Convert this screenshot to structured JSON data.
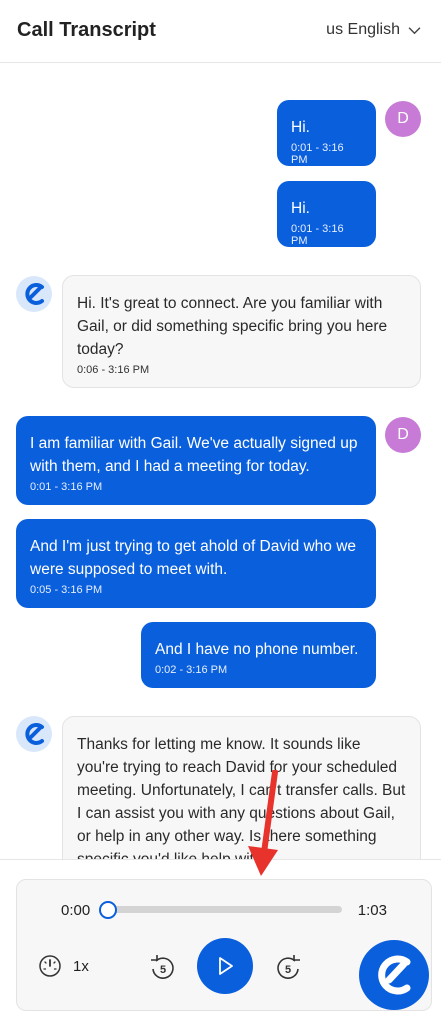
{
  "header": {
    "title": "Call Transcript",
    "language": "us English"
  },
  "messages": [
    {
      "role": "user",
      "avatar": "D",
      "text": "Hi.",
      "time": "0:01 - 3:16 PM"
    },
    {
      "role": "user",
      "avatar": "",
      "text": "Hi.",
      "time": "0:01 - 3:16 PM"
    },
    {
      "role": "assistant",
      "text": "Hi. It's great to connect. Are you familiar with Gail, or did something specific bring you here today?",
      "time": "0:06 - 3:16 PM"
    },
    {
      "role": "user",
      "avatar": "D",
      "text": "I am familiar with Gail. We've actually signed up with them, and I had a meeting for today.",
      "time": "0:01 - 3:16 PM"
    },
    {
      "role": "user",
      "avatar": "",
      "text": "And I'm just trying to get ahold of David who we were supposed to meet with.",
      "time": "0:05 - 3:16 PM"
    },
    {
      "role": "user",
      "avatar": "",
      "text": "And I have no phone number.",
      "time": "0:02 - 3:16 PM"
    },
    {
      "role": "assistant",
      "text": "Thanks for letting me know. It sounds like you're trying to reach David for your scheduled meeting. Unfortunately, I can't transfer calls. But I can assist you with any questions about Gail, or help in any other way. Is there something specific you'd like help with",
      "time": ""
    }
  ],
  "player": {
    "current_time": "0:00",
    "duration": "1:03",
    "progress": 0,
    "speed": "1x",
    "skip_back_seconds": "5",
    "skip_forward_seconds": "5"
  },
  "colors": {
    "accent": "#0a5fdc",
    "user_avatar": "#c77ad6",
    "annotation_arrow": "#e8322c"
  }
}
